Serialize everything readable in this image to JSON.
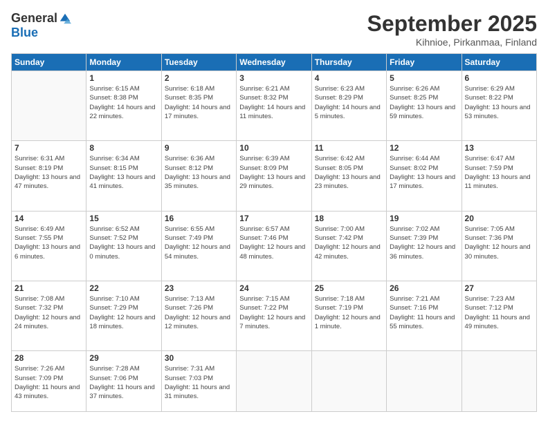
{
  "header": {
    "logo_general": "General",
    "logo_blue": "Blue",
    "title": "September 2025",
    "location": "Kihnioe, Pirkanmaa, Finland"
  },
  "weekdays": [
    "Sunday",
    "Monday",
    "Tuesday",
    "Wednesday",
    "Thursday",
    "Friday",
    "Saturday"
  ],
  "weeks": [
    [
      {
        "day": "",
        "sunrise": "",
        "sunset": "",
        "daylight": ""
      },
      {
        "day": "1",
        "sunrise": "Sunrise: 6:15 AM",
        "sunset": "Sunset: 8:38 PM",
        "daylight": "Daylight: 14 hours and 22 minutes."
      },
      {
        "day": "2",
        "sunrise": "Sunrise: 6:18 AM",
        "sunset": "Sunset: 8:35 PM",
        "daylight": "Daylight: 14 hours and 17 minutes."
      },
      {
        "day": "3",
        "sunrise": "Sunrise: 6:21 AM",
        "sunset": "Sunset: 8:32 PM",
        "daylight": "Daylight: 14 hours and 11 minutes."
      },
      {
        "day": "4",
        "sunrise": "Sunrise: 6:23 AM",
        "sunset": "Sunset: 8:29 PM",
        "daylight": "Daylight: 14 hours and 5 minutes."
      },
      {
        "day": "5",
        "sunrise": "Sunrise: 6:26 AM",
        "sunset": "Sunset: 8:25 PM",
        "daylight": "Daylight: 13 hours and 59 minutes."
      },
      {
        "day": "6",
        "sunrise": "Sunrise: 6:29 AM",
        "sunset": "Sunset: 8:22 PM",
        "daylight": "Daylight: 13 hours and 53 minutes."
      }
    ],
    [
      {
        "day": "7",
        "sunrise": "Sunrise: 6:31 AM",
        "sunset": "Sunset: 8:19 PM",
        "daylight": "Daylight: 13 hours and 47 minutes."
      },
      {
        "day": "8",
        "sunrise": "Sunrise: 6:34 AM",
        "sunset": "Sunset: 8:15 PM",
        "daylight": "Daylight: 13 hours and 41 minutes."
      },
      {
        "day": "9",
        "sunrise": "Sunrise: 6:36 AM",
        "sunset": "Sunset: 8:12 PM",
        "daylight": "Daylight: 13 hours and 35 minutes."
      },
      {
        "day": "10",
        "sunrise": "Sunrise: 6:39 AM",
        "sunset": "Sunset: 8:09 PM",
        "daylight": "Daylight: 13 hours and 29 minutes."
      },
      {
        "day": "11",
        "sunrise": "Sunrise: 6:42 AM",
        "sunset": "Sunset: 8:05 PM",
        "daylight": "Daylight: 13 hours and 23 minutes."
      },
      {
        "day": "12",
        "sunrise": "Sunrise: 6:44 AM",
        "sunset": "Sunset: 8:02 PM",
        "daylight": "Daylight: 13 hours and 17 minutes."
      },
      {
        "day": "13",
        "sunrise": "Sunrise: 6:47 AM",
        "sunset": "Sunset: 7:59 PM",
        "daylight": "Daylight: 13 hours and 11 minutes."
      }
    ],
    [
      {
        "day": "14",
        "sunrise": "Sunrise: 6:49 AM",
        "sunset": "Sunset: 7:55 PM",
        "daylight": "Daylight: 13 hours and 6 minutes."
      },
      {
        "day": "15",
        "sunrise": "Sunrise: 6:52 AM",
        "sunset": "Sunset: 7:52 PM",
        "daylight": "Daylight: 13 hours and 0 minutes."
      },
      {
        "day": "16",
        "sunrise": "Sunrise: 6:55 AM",
        "sunset": "Sunset: 7:49 PM",
        "daylight": "Daylight: 12 hours and 54 minutes."
      },
      {
        "day": "17",
        "sunrise": "Sunrise: 6:57 AM",
        "sunset": "Sunset: 7:46 PM",
        "daylight": "Daylight: 12 hours and 48 minutes."
      },
      {
        "day": "18",
        "sunrise": "Sunrise: 7:00 AM",
        "sunset": "Sunset: 7:42 PM",
        "daylight": "Daylight: 12 hours and 42 minutes."
      },
      {
        "day": "19",
        "sunrise": "Sunrise: 7:02 AM",
        "sunset": "Sunset: 7:39 PM",
        "daylight": "Daylight: 12 hours and 36 minutes."
      },
      {
        "day": "20",
        "sunrise": "Sunrise: 7:05 AM",
        "sunset": "Sunset: 7:36 PM",
        "daylight": "Daylight: 12 hours and 30 minutes."
      }
    ],
    [
      {
        "day": "21",
        "sunrise": "Sunrise: 7:08 AM",
        "sunset": "Sunset: 7:32 PM",
        "daylight": "Daylight: 12 hours and 24 minutes."
      },
      {
        "day": "22",
        "sunrise": "Sunrise: 7:10 AM",
        "sunset": "Sunset: 7:29 PM",
        "daylight": "Daylight: 12 hours and 18 minutes."
      },
      {
        "day": "23",
        "sunrise": "Sunrise: 7:13 AM",
        "sunset": "Sunset: 7:26 PM",
        "daylight": "Daylight: 12 hours and 12 minutes."
      },
      {
        "day": "24",
        "sunrise": "Sunrise: 7:15 AM",
        "sunset": "Sunset: 7:22 PM",
        "daylight": "Daylight: 12 hours and 7 minutes."
      },
      {
        "day": "25",
        "sunrise": "Sunrise: 7:18 AM",
        "sunset": "Sunset: 7:19 PM",
        "daylight": "Daylight: 12 hours and 1 minute."
      },
      {
        "day": "26",
        "sunrise": "Sunrise: 7:21 AM",
        "sunset": "Sunset: 7:16 PM",
        "daylight": "Daylight: 11 hours and 55 minutes."
      },
      {
        "day": "27",
        "sunrise": "Sunrise: 7:23 AM",
        "sunset": "Sunset: 7:12 PM",
        "daylight": "Daylight: 11 hours and 49 minutes."
      }
    ],
    [
      {
        "day": "28",
        "sunrise": "Sunrise: 7:26 AM",
        "sunset": "Sunset: 7:09 PM",
        "daylight": "Daylight: 11 hours and 43 minutes."
      },
      {
        "day": "29",
        "sunrise": "Sunrise: 7:28 AM",
        "sunset": "Sunset: 7:06 PM",
        "daylight": "Daylight: 11 hours and 37 minutes."
      },
      {
        "day": "30",
        "sunrise": "Sunrise: 7:31 AM",
        "sunset": "Sunset: 7:03 PM",
        "daylight": "Daylight: 11 hours and 31 minutes."
      },
      {
        "day": "",
        "sunrise": "",
        "sunset": "",
        "daylight": ""
      },
      {
        "day": "",
        "sunrise": "",
        "sunset": "",
        "daylight": ""
      },
      {
        "day": "",
        "sunrise": "",
        "sunset": "",
        "daylight": ""
      },
      {
        "day": "",
        "sunrise": "",
        "sunset": "",
        "daylight": ""
      }
    ]
  ]
}
